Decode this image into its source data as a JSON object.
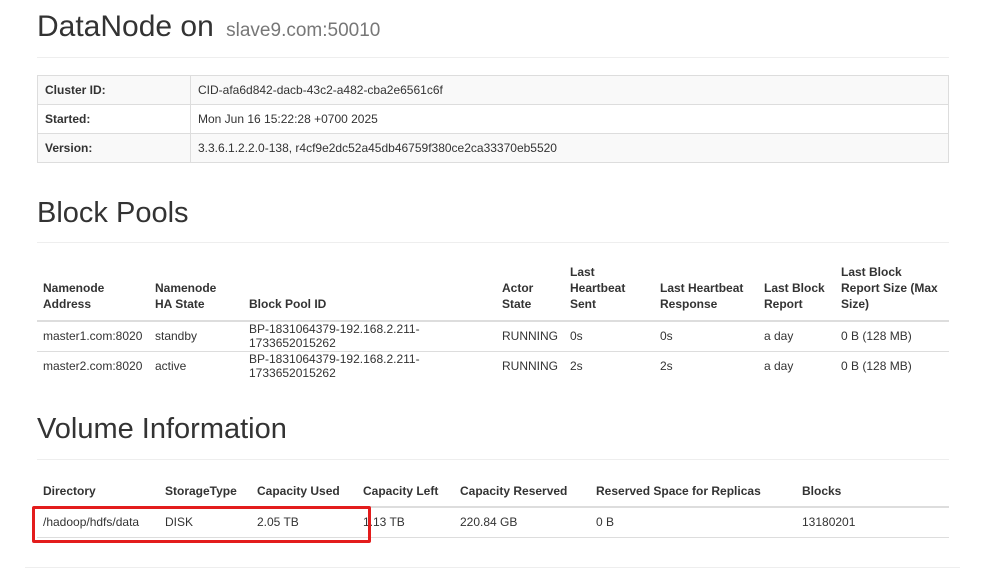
{
  "header": {
    "title": "DataNode on",
    "host": "slave9.com:50010"
  },
  "overview": [
    {
      "label": "Cluster ID:",
      "value": "CID-afa6d842-dacb-43c2-a482-cba2e6561c6f"
    },
    {
      "label": "Started:",
      "value": "Mon Jun 16 15:22:28 +0700 2025"
    },
    {
      "label": "Version:",
      "value": "3.3.6.1.2.2.0-138, r4cf9e2dc52a45db46759f380ce2ca33370eb5520"
    }
  ],
  "block_pools": {
    "title": "Block Pools",
    "columns": [
      "Namenode Address",
      "Namenode HA State",
      "Block Pool ID",
      "Actor State",
      "Last Heartbeat Sent",
      "Last Heartbeat Response",
      "Last Block Report",
      "Last Block Report Size (Max Size)"
    ],
    "rows": [
      [
        "master1.com:8020",
        "standby",
        "BP-1831064379-192.168.2.211-1733652015262",
        "RUNNING",
        "0s",
        "0s",
        "a day",
        "0 B (128 MB)"
      ],
      [
        "master2.com:8020",
        "active",
        "BP-1831064379-192.168.2.211-1733652015262",
        "RUNNING",
        "2s",
        "2s",
        "a day",
        "0 B (128 MB)"
      ]
    ]
  },
  "volume": {
    "title": "Volume Information",
    "columns": [
      "Directory",
      "StorageType",
      "Capacity Used",
      "Capacity Left",
      "Capacity Reserved",
      "Reserved Space for Replicas",
      "Blocks"
    ],
    "rows": [
      [
        "/hadoop/hdfs/data",
        "DISK",
        "2.05 TB",
        "1.13 TB",
        "220.84 GB",
        "0 B",
        "13180201"
      ]
    ]
  },
  "colors": {
    "highlight": "#e31c1c"
  }
}
